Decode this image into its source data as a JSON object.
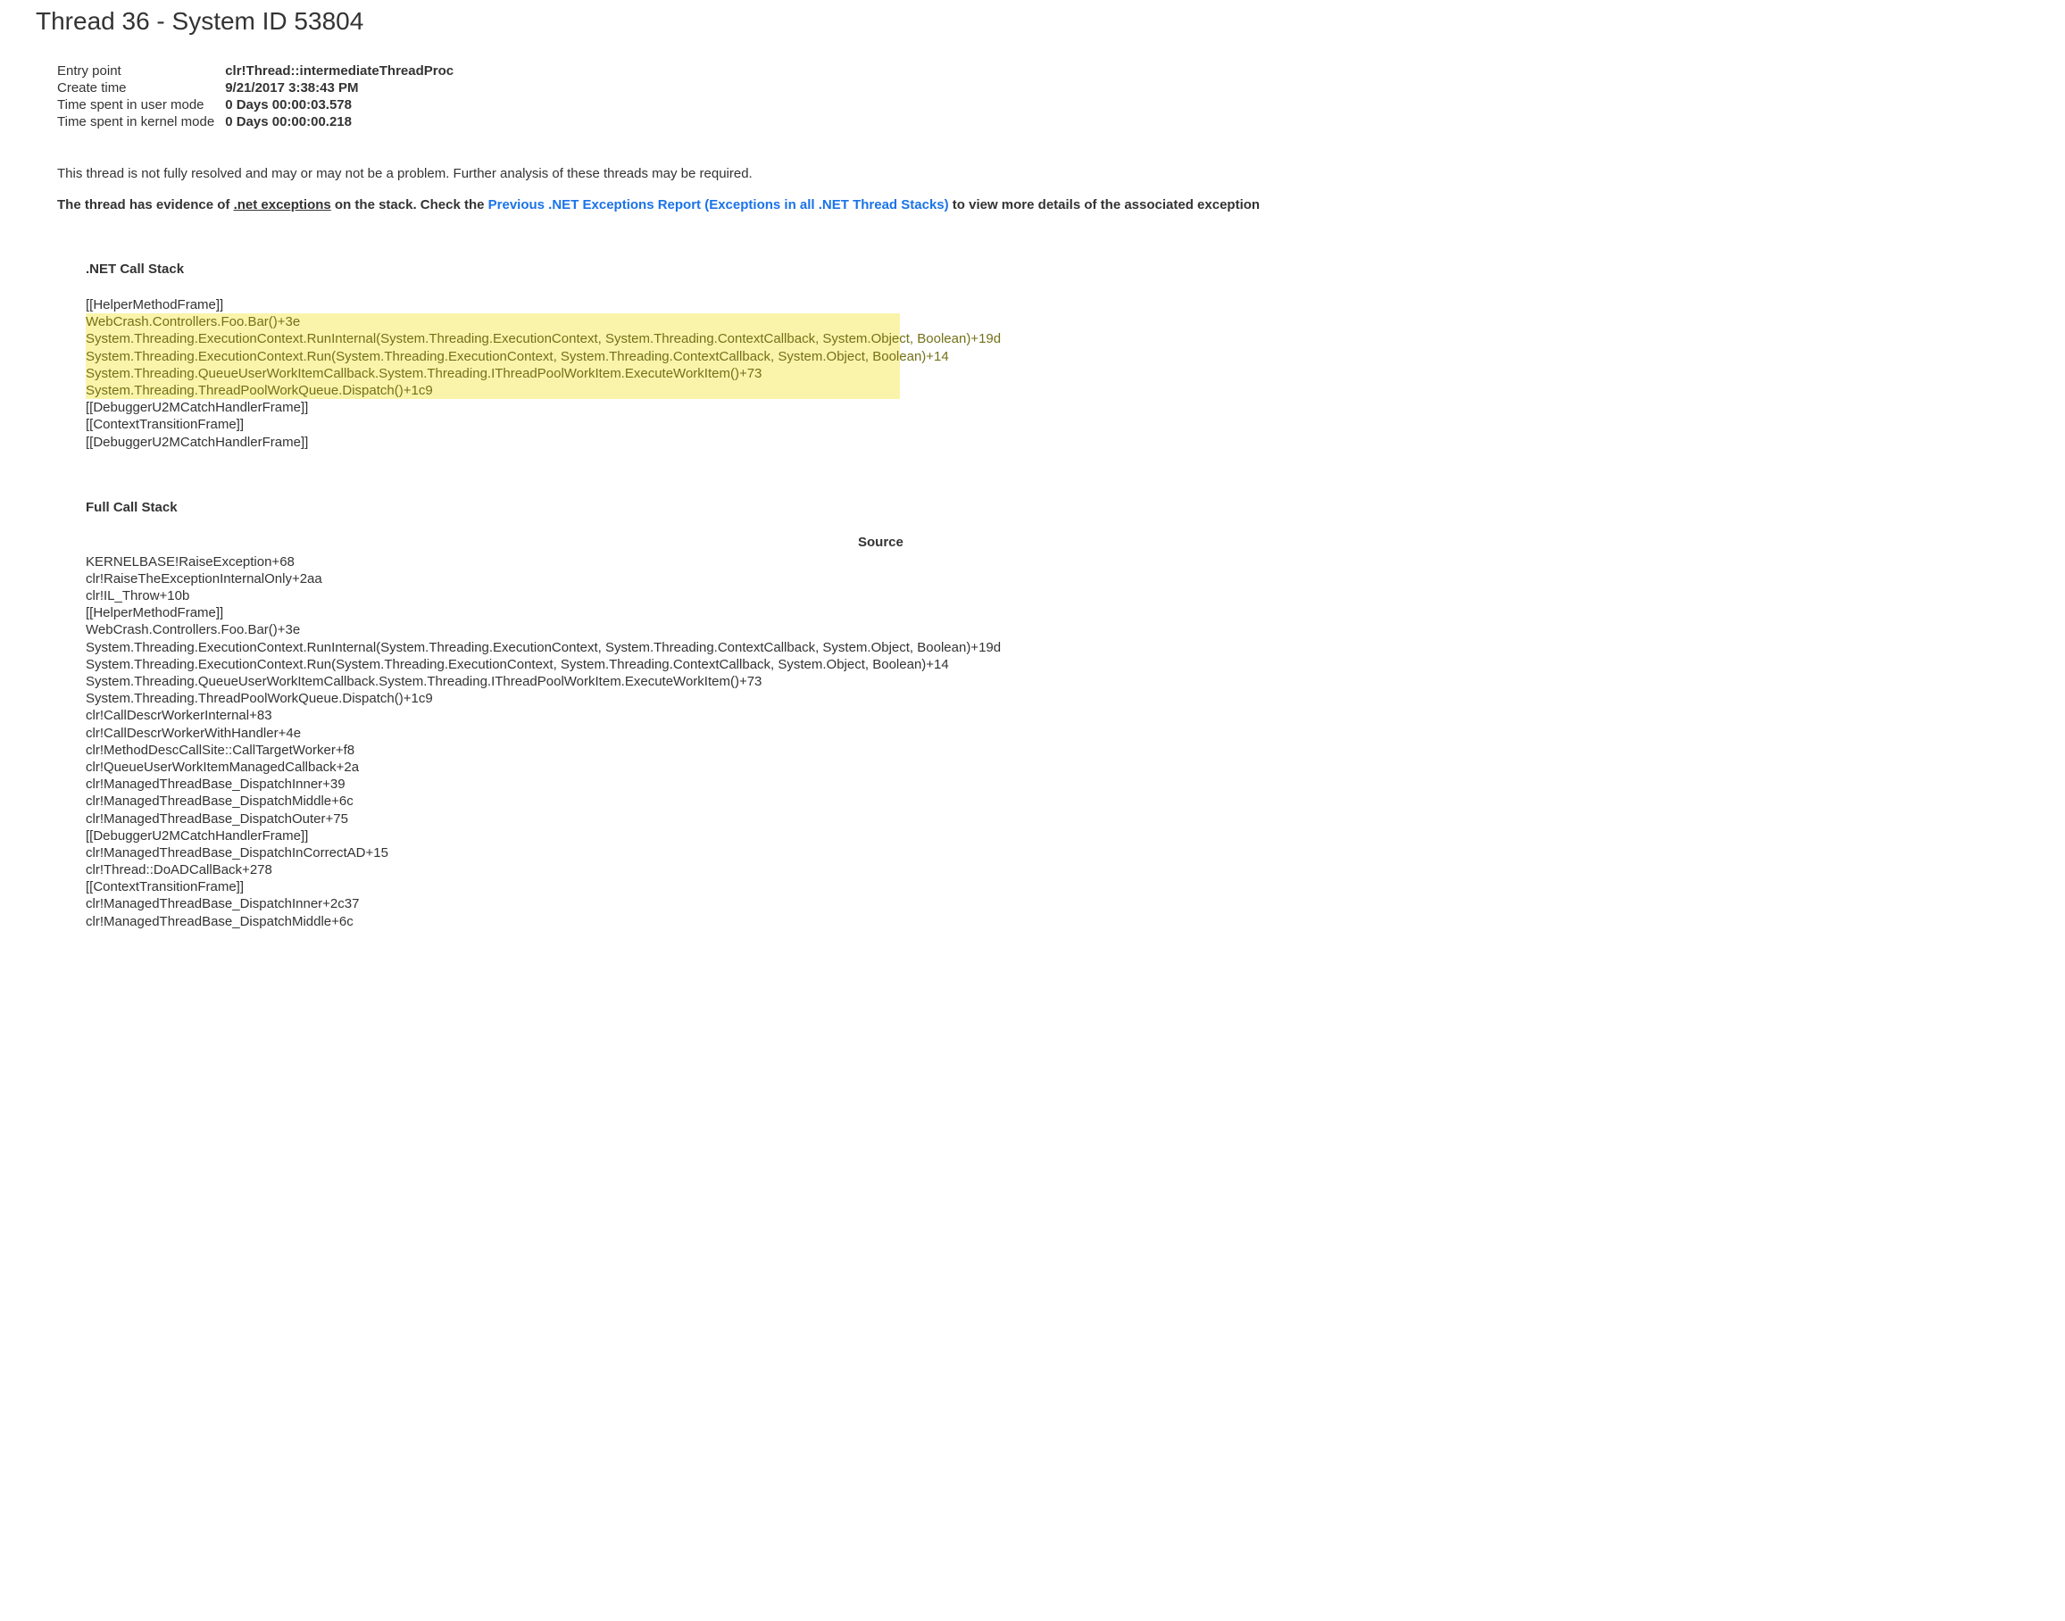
{
  "title": "Thread 36 - System ID 53804",
  "info": {
    "entry_point_label": "Entry point",
    "entry_point_value": "clr!Thread::intermediateThreadProc",
    "create_time_label": "Create time",
    "create_time_value": "9/21/2017 3:38:43 PM",
    "user_mode_label": "Time spent in user mode",
    "user_mode_value": "0 Days 00:00:03.578",
    "kernel_mode_label": "Time spent in kernel mode",
    "kernel_mode_value": "0 Days 00:00:00.218"
  },
  "note_text": "This thread is not fully resolved and may or may not be a problem. Further analysis of these threads may be required.",
  "evidence_pre": "The thread has evidence of ",
  "evidence_underline": ".net exceptions",
  "evidence_mid": " on the stack. Check the ",
  "evidence_link": "Previous .NET Exceptions Report (Exceptions in all .NET Thread Stacks)",
  "evidence_post": " to view more details of the associated exception",
  "net_stack_heading": ".NET Call Stack",
  "net_stack": [
    {
      "t": "[[HelperMethodFrame]]",
      "hl": false
    },
    {
      "t": "WebCrash.Controllers.Foo.Bar()+3e",
      "hl": true
    },
    {
      "t": "System.Threading.ExecutionContext.RunInternal(System.Threading.ExecutionContext, System.Threading.ContextCallback, System.Object, Boolean)+19d",
      "hl": true
    },
    {
      "t": "System.Threading.ExecutionContext.Run(System.Threading.ExecutionContext, System.Threading.ContextCallback, System.Object, Boolean)+14",
      "hl": true
    },
    {
      "t": "System.Threading.QueueUserWorkItemCallback.System.Threading.IThreadPoolWorkItem.ExecuteWorkItem()+73",
      "hl": true
    },
    {
      "t": "System.Threading.ThreadPoolWorkQueue.Dispatch()+1c9",
      "hl": true
    },
    {
      "t": "[[DebuggerU2MCatchHandlerFrame]]",
      "hl": false
    },
    {
      "t": "[[ContextTransitionFrame]]",
      "hl": false
    },
    {
      "t": "[[DebuggerU2MCatchHandlerFrame]]",
      "hl": false
    }
  ],
  "full_stack_heading": "Full Call Stack",
  "source_heading": "Source",
  "full_stack": [
    "KERNELBASE!RaiseException+68",
    "clr!RaiseTheExceptionInternalOnly+2aa",
    "clr!IL_Throw+10b",
    "[[HelperMethodFrame]]",
    "WebCrash.Controllers.Foo.Bar()+3e",
    "System.Threading.ExecutionContext.RunInternal(System.Threading.ExecutionContext, System.Threading.ContextCallback, System.Object, Boolean)+19d",
    "System.Threading.ExecutionContext.Run(System.Threading.ExecutionContext, System.Threading.ContextCallback, System.Object, Boolean)+14",
    "System.Threading.QueueUserWorkItemCallback.System.Threading.IThreadPoolWorkItem.ExecuteWorkItem()+73",
    "System.Threading.ThreadPoolWorkQueue.Dispatch()+1c9",
    "clr!CallDescrWorkerInternal+83",
    "clr!CallDescrWorkerWithHandler+4e",
    "clr!MethodDescCallSite::CallTargetWorker+f8",
    "clr!QueueUserWorkItemManagedCallback+2a",
    "clr!ManagedThreadBase_DispatchInner+39",
    "clr!ManagedThreadBase_DispatchMiddle+6c",
    "clr!ManagedThreadBase_DispatchOuter+75",
    "[[DebuggerU2MCatchHandlerFrame]]",
    "clr!ManagedThreadBase_DispatchInCorrectAD+15",
    "clr!Thread::DoADCallBack+278",
    "[[ContextTransitionFrame]]",
    "clr!ManagedThreadBase_DispatchInner+2c37",
    "clr!ManagedThreadBase_DispatchMiddle+6c"
  ]
}
